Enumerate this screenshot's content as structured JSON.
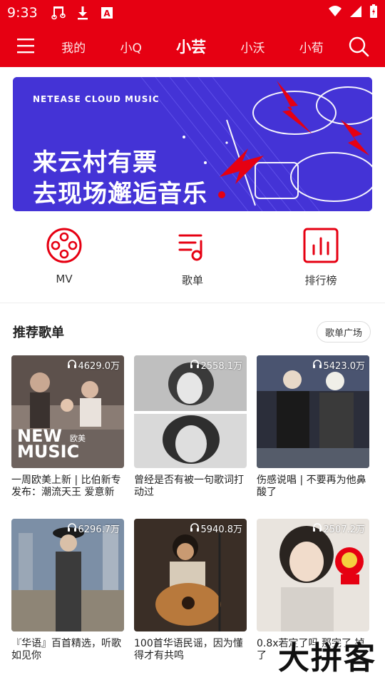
{
  "status_bar": {
    "time": "9:33",
    "icons": [
      "music-note-icon",
      "download-icon",
      "a-box-icon"
    ],
    "right_icons": [
      "wifi-icon",
      "signal-icon",
      "battery-icon"
    ]
  },
  "top_bar": {
    "tabs": [
      "我的",
      "小Q",
      "小芸",
      "小沃",
      "小荀"
    ],
    "active_tab": "小芸"
  },
  "banner": {
    "brand": "NETEASE CLOUD MUSIC",
    "line1": "来云村有票",
    "line2": "去现场邂逅音乐"
  },
  "quick_access": [
    {
      "label": "MV",
      "icon": "film-reel-icon"
    },
    {
      "label": "歌单",
      "icon": "playlist-icon"
    },
    {
      "label": "排行榜",
      "icon": "chart-icon"
    }
  ],
  "section": {
    "title": "推荐歌单",
    "plaza_button": "歌单广场"
  },
  "playlists": [
    {
      "plays": "4629.0万",
      "title": "一周欧美上新 | 比伯新专发布：潮流天王 爱意新章",
      "cover_text": "NEW MUSIC",
      "cover_sub": "欧美"
    },
    {
      "plays": "2558.1万",
      "title": "曾经是否有被一句歌词打动过"
    },
    {
      "plays": "5423.0万",
      "title": "伤感说唱 | 不要再为他鼻酸了"
    },
    {
      "plays": "6296.7万",
      "title": "『华语』百首精选，听歌如见你"
    },
    {
      "plays": "5940.8万",
      "title": "100首华语民谣，因为懂得才有共鸣"
    },
    {
      "plays": "2507.2万",
      "title": "0.8x若定了吗 那完了 掉了"
    }
  ],
  "watermark": "大拼客",
  "colors": {
    "brand_red": "#e60012",
    "banner_blue": "#4433d6"
  }
}
